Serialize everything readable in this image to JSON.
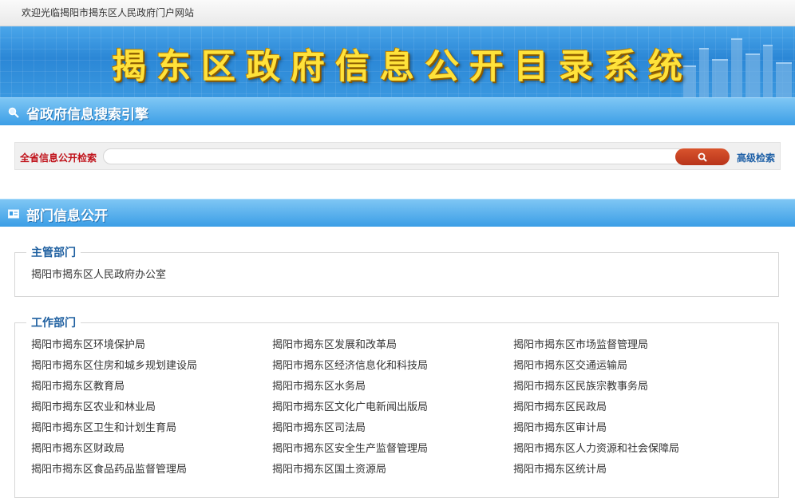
{
  "topbar": {
    "welcome": "欢迎光临揭阳市揭东区人民政府门户网站"
  },
  "banner": {
    "title": "揭东区政府信息公开目录系统"
  },
  "search_section": {
    "header": "省政府信息搜索引擎",
    "label": "全省信息公开检索",
    "input_value": "",
    "search_icon": "search-icon",
    "advanced": "高级检索"
  },
  "dept_section": {
    "header": "部门信息公开",
    "main_dept": {
      "legend": "主管部门",
      "items": [
        "揭阳市揭东区人民政府办公室"
      ]
    },
    "work_dept": {
      "legend": "工作部门",
      "items": [
        "揭阳市揭东区环境保护局",
        "揭阳市揭东区发展和改革局",
        "揭阳市揭东区市场监督管理局",
        "揭阳市揭东区住房和城乡规划建设局",
        "揭阳市揭东区经济信息化和科技局",
        "揭阳市揭东区交通运输局",
        "揭阳市揭东区教育局",
        "揭阳市揭东区水务局",
        "揭阳市揭东区民族宗教事务局",
        "揭阳市揭东区农业和林业局",
        "揭阳市揭东区文化广电新闻出版局",
        "揭阳市揭东区民政局",
        "揭阳市揭东区卫生和计划生育局",
        "揭阳市揭东区司法局",
        "揭阳市揭东区审计局",
        "揭阳市揭东区财政局",
        "揭阳市揭东区安全生产监督管理局",
        "揭阳市揭东区人力资源和社会保障局",
        "揭阳市揭东区食品药品监督管理局",
        "揭阳市揭东区国土资源局",
        "揭阳市揭东区统计局"
      ]
    }
  }
}
